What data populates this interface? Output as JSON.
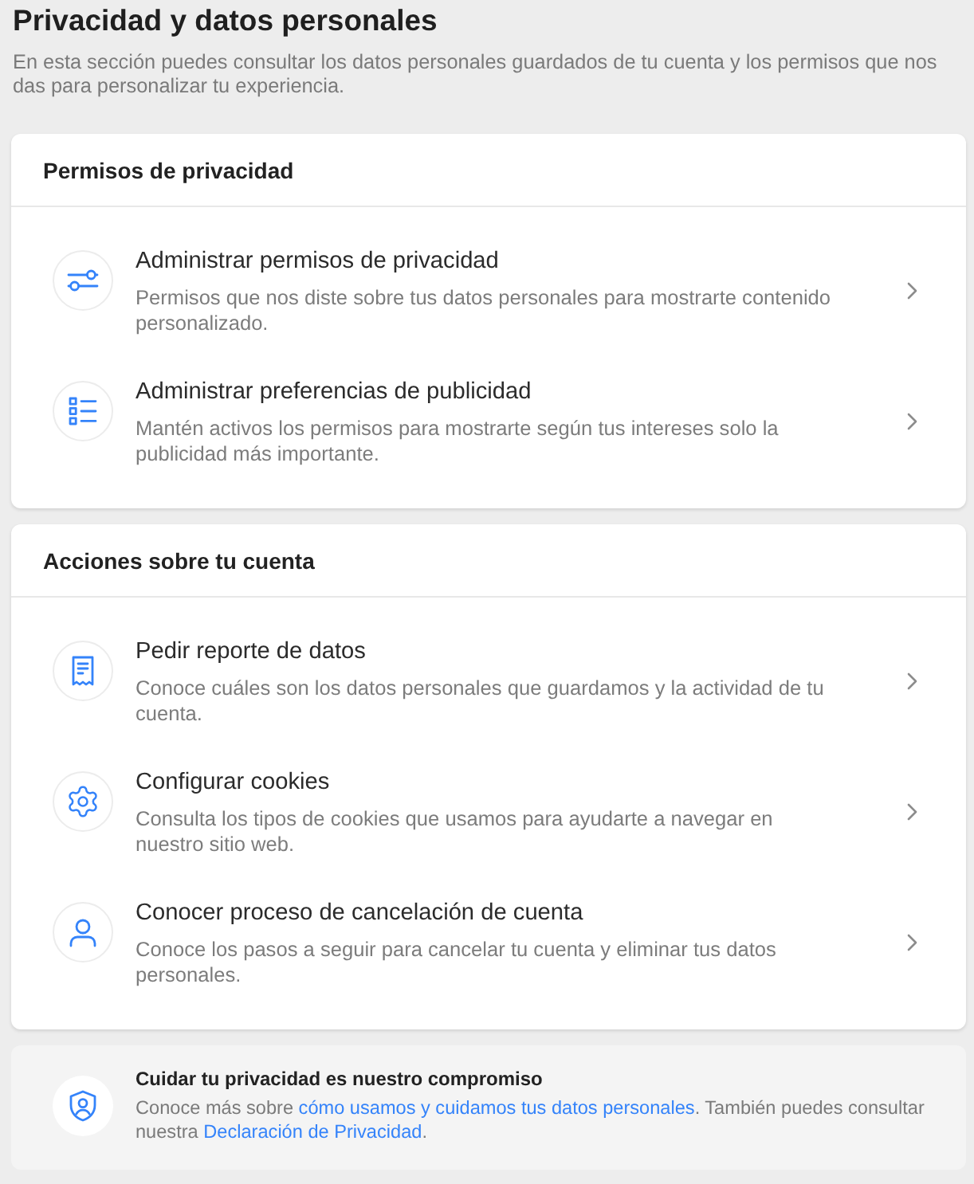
{
  "page": {
    "title": "Privacidad y datos personales",
    "description": "En esta sección puedes consultar los datos personales guardados de tu cuenta y los permisos que nos das para personalizar tu experiencia."
  },
  "sections": [
    {
      "title": "Permisos de privacidad",
      "items": [
        {
          "title": "Administrar permisos de privacidad",
          "description": "Permisos que nos diste sobre tus datos personales para mostrarte contenido personalizado."
        },
        {
          "title": "Administrar preferencias de publicidad",
          "description": "Mantén activos los permisos para mostrarte según tus intereses solo la publicidad más importante."
        }
      ]
    },
    {
      "title": "Acciones sobre tu cuenta",
      "items": [
        {
          "title": "Pedir reporte de datos",
          "description": "Conoce cuáles son los datos personales que guardamos y la actividad de tu cuenta."
        },
        {
          "title": "Configurar cookies",
          "description": "Consulta los tipos de cookies que usamos para ayudarte a navegar en nuestro sitio web."
        },
        {
          "title": "Conocer proceso de cancelación de cuenta",
          "description": "Conoce los pasos a seguir para cancelar tu cuenta y eliminar tus datos personales."
        }
      ]
    }
  ],
  "footer": {
    "title": "Cuidar tu privacidad es nuestro compromiso",
    "text": [
      {
        "kind": "text",
        "text": "Conoce más sobre "
      },
      {
        "kind": "link",
        "text": "cómo usamos y cuidamos tus datos personales"
      },
      {
        "kind": "text",
        "text": ". También puedes consultar nuestra "
      },
      {
        "kind": "link",
        "text": "Declaración de Privacidad"
      },
      {
        "kind": "text",
        "text": "."
      }
    ]
  }
}
